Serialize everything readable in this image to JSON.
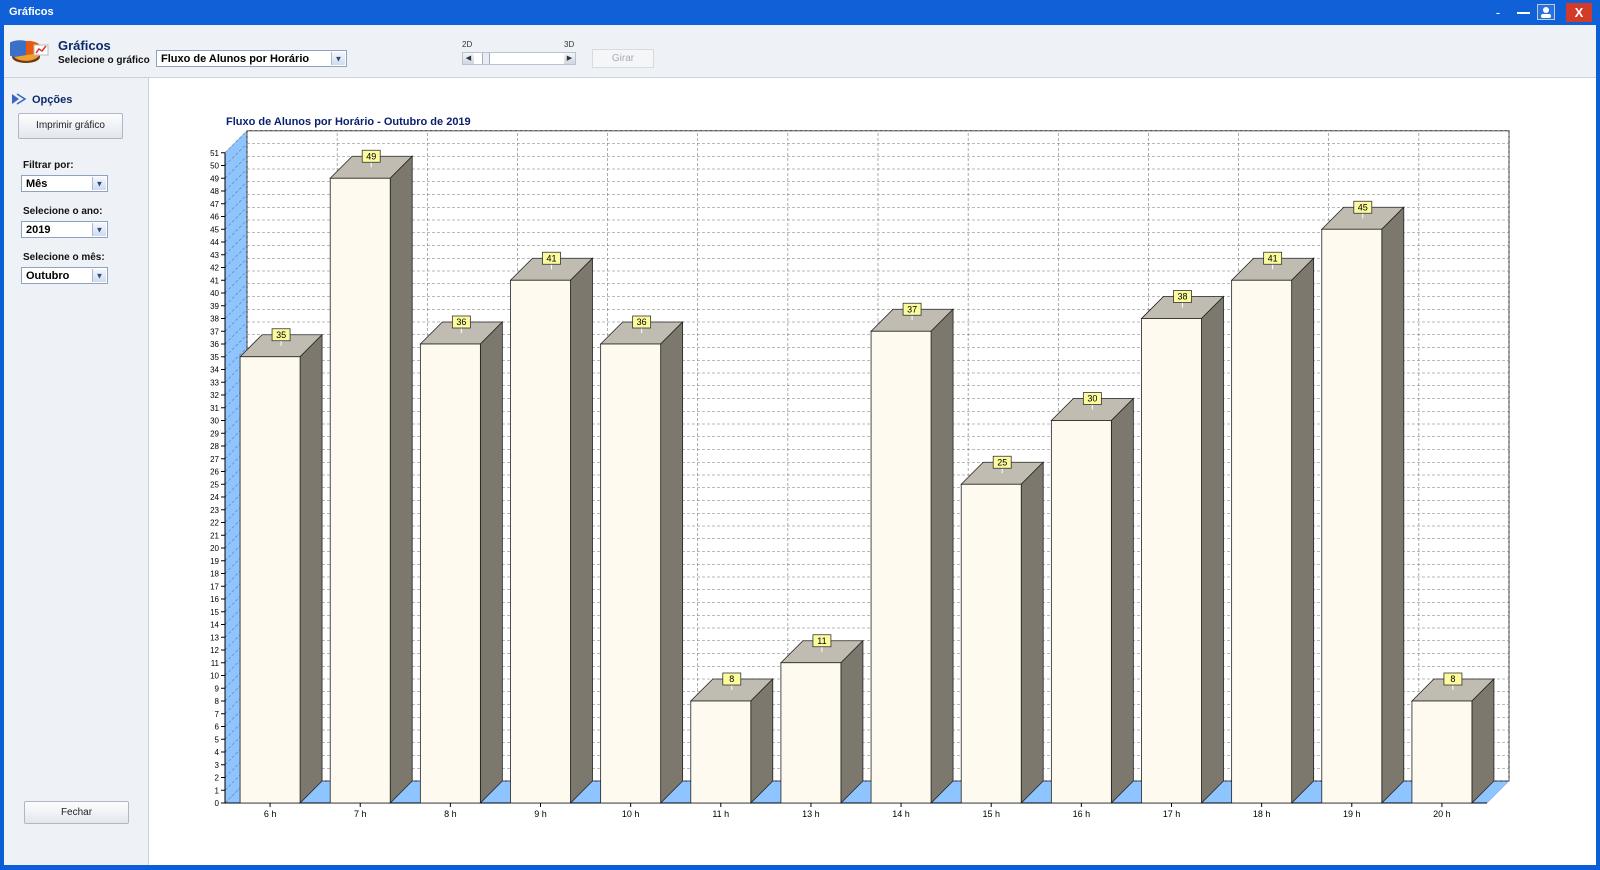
{
  "window": {
    "title": "Gráficos",
    "close_label": "X",
    "minimize_label": "-"
  },
  "header": {
    "title": "Gráficos",
    "select_label": "Selecione o gráfico",
    "chart_select_value": "Fluxo de Alunos por Horário",
    "label_2d": "2D",
    "label_3d": "3D",
    "girar_label": "Girar",
    "slider_level": 0.1
  },
  "sidebar": {
    "opcoes_label": "Opções",
    "print_label": "Imprimir gráfico",
    "filter_label": "Filtrar por:",
    "filter_value": "Mês",
    "year_label": "Selecione o ano:",
    "year_value": "2019",
    "month_label": "Selecione o mês:",
    "month_value": "Outubro",
    "close_label": "Fechar"
  },
  "colors": {
    "bar_front": "#fefaf0",
    "bar_side": "#7c786e",
    "bar_top": "#c0bcb1",
    "wall": "#8ec4ff",
    "label_bg": "#fcfc9e",
    "title": "#0a1f6e"
  },
  "chart_data": {
    "type": "bar",
    "title": "Fluxo de Alunos por Horário - Outubro de 2019",
    "categories": [
      "6 h",
      "7 h",
      "8 h",
      "9 h",
      "10 h",
      "11 h",
      "13 h",
      "14 h",
      "15 h",
      "16 h",
      "17 h",
      "18 h",
      "19 h",
      "20 h"
    ],
    "values": [
      35,
      49,
      36,
      41,
      36,
      8,
      11,
      37,
      25,
      30,
      38,
      41,
      45,
      8
    ],
    "ylim": [
      0,
      51
    ],
    "yticks": [
      "0",
      "1",
      "2",
      "3",
      "4",
      "5",
      "6",
      "7",
      "8",
      "9",
      "10",
      "11",
      "12",
      "13",
      "14",
      "15",
      "16",
      "17",
      "18",
      "19",
      "20",
      "21",
      "22",
      "23",
      "24",
      "25",
      "26",
      "27",
      "28",
      "29",
      "30",
      "31",
      "32",
      "33",
      "34",
      "35",
      "36",
      "37",
      "38",
      "39",
      "40",
      "41",
      "42",
      "43",
      "44",
      "45",
      "46",
      "47",
      "48",
      "49",
      "50",
      "51"
    ],
    "grid": true,
    "style": "3d"
  }
}
